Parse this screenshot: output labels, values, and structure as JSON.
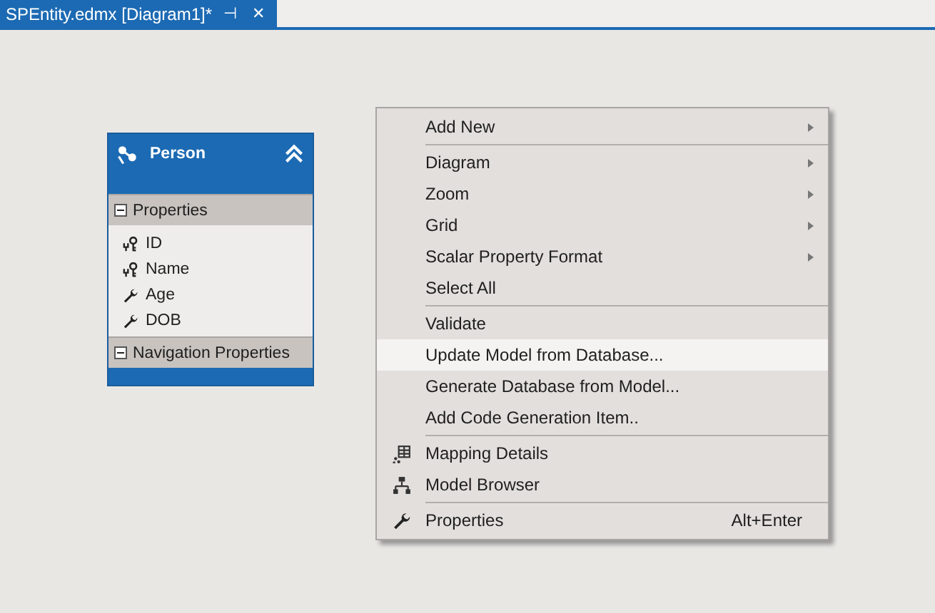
{
  "tab": {
    "title": "SPEntity.edmx [Diagram1]*",
    "pin": "⊣",
    "close": "✕"
  },
  "entity": {
    "name": "Person",
    "expanded": true,
    "sections": [
      {
        "title": "Properties",
        "expanded": true,
        "items": [
          {
            "label": "ID",
            "kind": "key"
          },
          {
            "label": "Name",
            "kind": "key"
          },
          {
            "label": "Age",
            "kind": "wrench"
          },
          {
            "label": "DOB",
            "kind": "wrench"
          }
        ]
      },
      {
        "title": "Navigation Properties",
        "expanded": true
      }
    ]
  },
  "menu": {
    "groups": [
      [
        {
          "label": "Add New",
          "submenu": true,
          "selected": false
        }
      ],
      [
        {
          "label": "Diagram",
          "submenu": true,
          "selected": false
        },
        {
          "label": "Zoom",
          "submenu": true,
          "selected": false
        },
        {
          "label": "Grid",
          "submenu": true,
          "selected": false
        },
        {
          "label": "Scalar Property Format",
          "submenu": true,
          "selected": false
        },
        {
          "label": "Select All",
          "submenu": false,
          "selected": false
        }
      ],
      [
        {
          "label": "Validate",
          "submenu": false,
          "selected": false
        },
        {
          "label": "Update Model from Database...",
          "submenu": false,
          "selected": true
        },
        {
          "label": "Generate Database from Model...",
          "submenu": false,
          "selected": false
        },
        {
          "label": "Add Code Generation Item..",
          "submenu": false,
          "selected": false
        }
      ],
      [
        {
          "label": "Mapping Details",
          "submenu": false,
          "selected": false,
          "kind": "table"
        },
        {
          "label": "Model Browser",
          "submenu": false,
          "selected": false,
          "kind": "hierarchy"
        }
      ],
      [
        {
          "label": "Properties",
          "submenu": false,
          "selected": false,
          "kind": "wrench",
          "shortcut": "Alt+Enter"
        }
      ]
    ]
  }
}
